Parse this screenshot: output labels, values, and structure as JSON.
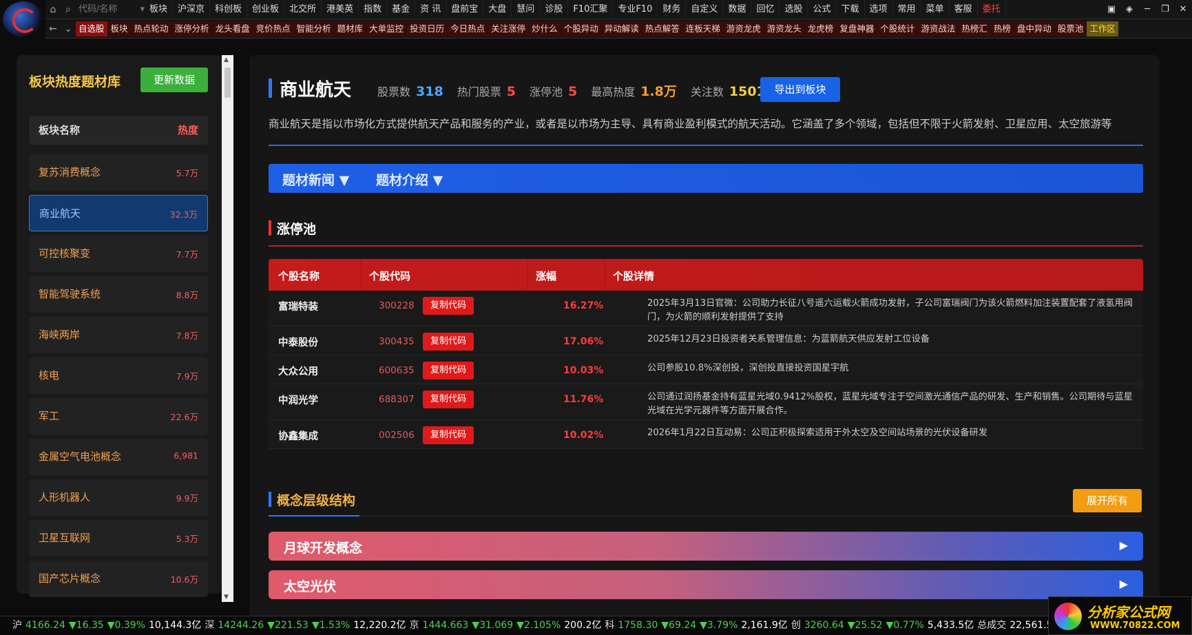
{
  "toolbar": {
    "search_placeholder": "代码/名称",
    "menu": [
      "板块",
      "沪深京",
      "科创板",
      "创业板",
      "北交所",
      "港美英",
      "指数",
      "基金",
      "资 讯",
      "盘前宝",
      "大盘",
      "慧问",
      "诊股",
      "F10汇聚",
      "专业F10",
      "财务",
      "自定义",
      "数据",
      "回忆",
      "选股",
      "公式",
      "下载",
      "选项",
      "常用",
      "菜单",
      "客服",
      "委托"
    ],
    "submenu": [
      "自选股",
      "板块",
      "热点轮动",
      "涨停分析",
      "龙头看盘",
      "竞价热点",
      "智能分析",
      "题材库",
      "大单监控",
      "投资日历",
      "今日热点",
      "关注涨停",
      "炒什么",
      "个股异动",
      "异动解读",
      "热点解答",
      "连板天梯",
      "游资龙虎",
      "游资龙头",
      "龙虎榜",
      "复盘神器",
      "个股统计",
      "游资战法",
      "热榜汇",
      "热榜",
      "盘中异动",
      "股票池",
      "工作区"
    ],
    "window": {
      "min": "─",
      "max": "❐",
      "close": "✕"
    }
  },
  "left": {
    "title": "板块热度题材库",
    "update_button": "更新数据",
    "col_name": "板块名称",
    "col_heat": "热度",
    "sectors": [
      {
        "name": "复苏消费概念",
        "heat": "5.7万"
      },
      {
        "name": "商业航天",
        "heat": "32.3万",
        "selected": true
      },
      {
        "name": "可控核聚变",
        "heat": "7.7万"
      },
      {
        "name": "智能驾驶系统",
        "heat": "8.8万"
      },
      {
        "name": "海峡两岸",
        "heat": "7.8万"
      },
      {
        "name": "核电",
        "heat": "7.9万"
      },
      {
        "name": "军工",
        "heat": "22.6万"
      },
      {
        "name": "金属空气电池概念",
        "heat": "6,981"
      },
      {
        "name": "人形机器人",
        "heat": "9.9万"
      },
      {
        "name": "卫星互联网",
        "heat": "5.3万"
      },
      {
        "name": "国产芯片概念",
        "heat": "10.6万"
      }
    ]
  },
  "main": {
    "title": "商业航天",
    "stats": [
      {
        "label": "股票数",
        "value": "318",
        "color": "#4aa8ff"
      },
      {
        "label": "热门股票",
        "value": "5",
        "color": "#ff4a4a"
      },
      {
        "label": "涨停池",
        "value": "5",
        "color": "#ff4a4a"
      },
      {
        "label": "最高热度",
        "value": "1.8万",
        "color": "#f4a030"
      },
      {
        "label": "关注数",
        "value": "15011",
        "color": "#f4d040"
      }
    ],
    "export_button": "导出到板块",
    "description": "商业航天是指以市场化方式提供航天产品和服务的产业，或者是以市场为主导、具有商业盈利模式的航天活动。它涵盖了多个领域，包括但不限于火箭发射、卫星应用、太空旅游等",
    "tabs": [
      "题材新闻 ▼",
      "题材介绍 ▼"
    ],
    "limit_pool_title": "涨停池",
    "table_headers": [
      "个股名称",
      "个股代码",
      "涨幅",
      "个股详情"
    ],
    "copy_label": "复制代码",
    "stocks": [
      {
        "name": "富瑞特装",
        "code": "300228",
        "pct": "16.27%",
        "detail": "2025年3月13日官微：公司助力长征八号遥六运载火箭成功发射，子公司富瑞阀门为该火箭燃料加注装置配套了液氢用阀门，为火箭的顺利发射提供了支持"
      },
      {
        "name": "中泰股份",
        "code": "300435",
        "pct": "17.06%",
        "detail": "2025年12月23日投资者关系管理信息：为蓝箭航天供应发射工位设备"
      },
      {
        "name": "大众公用",
        "code": "600635",
        "pct": "10.03%",
        "detail": "公司参股10.8%深创投，深创投直接投资国星宇航"
      },
      {
        "name": "中润光学",
        "code": "688307",
        "pct": "11.76%",
        "detail": "公司通过润扬基金持有蓝星光域0.9412%股权，蓝星光域专注于空间激光通信产品的研发、生产和销售。公司期待与蓝星光域在光学元器件等方面开展合作。"
      },
      {
        "name": "协鑫集成",
        "code": "002506",
        "pct": "10.02%",
        "detail": "2026年1月22日互动易：公司正积极探索适用于外太空及空间站场景的光伏设备研发"
      }
    ],
    "concept_title": "概念层级结构",
    "expand_button": "展开所有",
    "concepts": [
      "月球开发概念",
      "太空光伏"
    ],
    "concept_arrow": "▶"
  },
  "ticker": [
    {
      "label": "沪",
      "index": "4166.24",
      "change": "▼16.35",
      "pct": "▼0.39%",
      "vol": "10,144.3亿"
    },
    {
      "label": "深",
      "index": "14244.26",
      "change": "▼221.53",
      "pct": "▼1.53%",
      "vol": "12,220.2亿"
    },
    {
      "label": "京",
      "index": "1444.663",
      "change": "▼31.069",
      "pct": "▼2.105%",
      "vol": "200.2亿"
    },
    {
      "label": "科",
      "index": "1758.30",
      "change": "▼69.24",
      "pct": "▼3.79%",
      "vol": "2,161.9亿"
    },
    {
      "label": "创",
      "index": "3260.64",
      "change": "▼25.52",
      "pct": "▼0.77%",
      "vol": "5,433.5亿"
    }
  ],
  "ticker_total_label": "总成交",
  "ticker_total": "22,561.5亿",
  "brand": {
    "name": "分析家公式网",
    "url": "WWW.70822.COM"
  }
}
